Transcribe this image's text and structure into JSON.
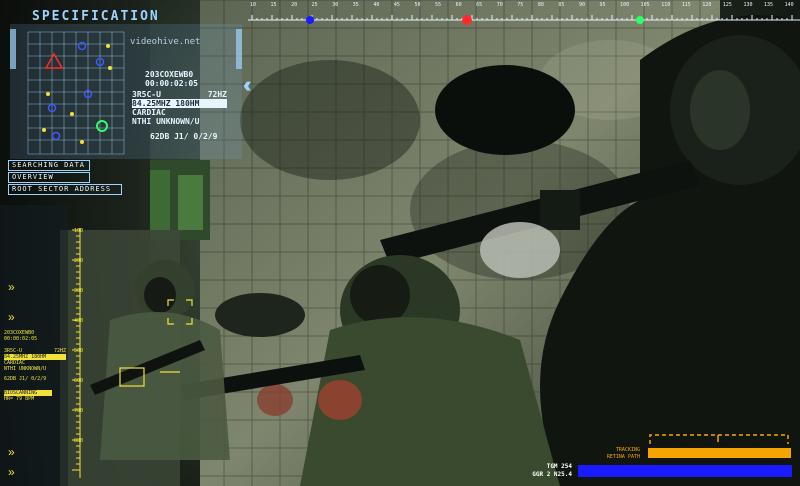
{
  "hud": {
    "title": "SPECIFICATION",
    "watermark": "videohive.net",
    "readout": {
      "line1": "203COXEWB0",
      "line2": "00:00:02:05",
      "line3": "3R5C-U",
      "line3b": "72HZ",
      "line4": "84.25MHZ 180HM",
      "line5": "CARDIAC",
      "line6": "NTHI UNKNOWN/U",
      "line7": "62DB J1/ 0/2/9"
    },
    "menu": [
      "SEARCHING DATA",
      "OVERVIEW",
      "ROOT SECTOR ADDRESS"
    ],
    "left_panel": {
      "l1": "203COXEWB0",
      "l2": "00:00:02:05",
      "l3": "3R5C-U",
      "l3b": "72HZ",
      "l4": "84.25MHZ 180HM",
      "l5": "CARDIAC",
      "l6": "NTHI UNKNOWN/U",
      "l7": "62DB J1/ 0/2/9",
      "l8": "BIOSCANNING",
      "l9": "HR= 79 BPM"
    },
    "ruler_labels": [
      "10",
      "15",
      "20",
      "25",
      "30",
      "35",
      "40",
      "45",
      "50",
      "55",
      "60",
      "65",
      "70",
      "75",
      "80",
      "85",
      "90",
      "95",
      "100",
      "105",
      "110",
      "115",
      "120",
      "125",
      "130",
      "135",
      "140"
    ],
    "vertical_scale": [
      "100",
      "200",
      "300",
      "400",
      "500",
      "600",
      "700",
      "800"
    ],
    "bottom": {
      "tgm": "TGM 254",
      "ggr": "GGR 2 N25.4",
      "tracking": "TRACKING",
      "retina": "RETINA PATH"
    }
  },
  "colors": {
    "hud_blue": "#9fd3ff",
    "hud_yellow": "#f0e23a",
    "hud_red": "#ff2a2a",
    "hud_green": "#2fff6a",
    "bar_orange": "#f5a400",
    "bar_blue": "#1a1aff"
  }
}
